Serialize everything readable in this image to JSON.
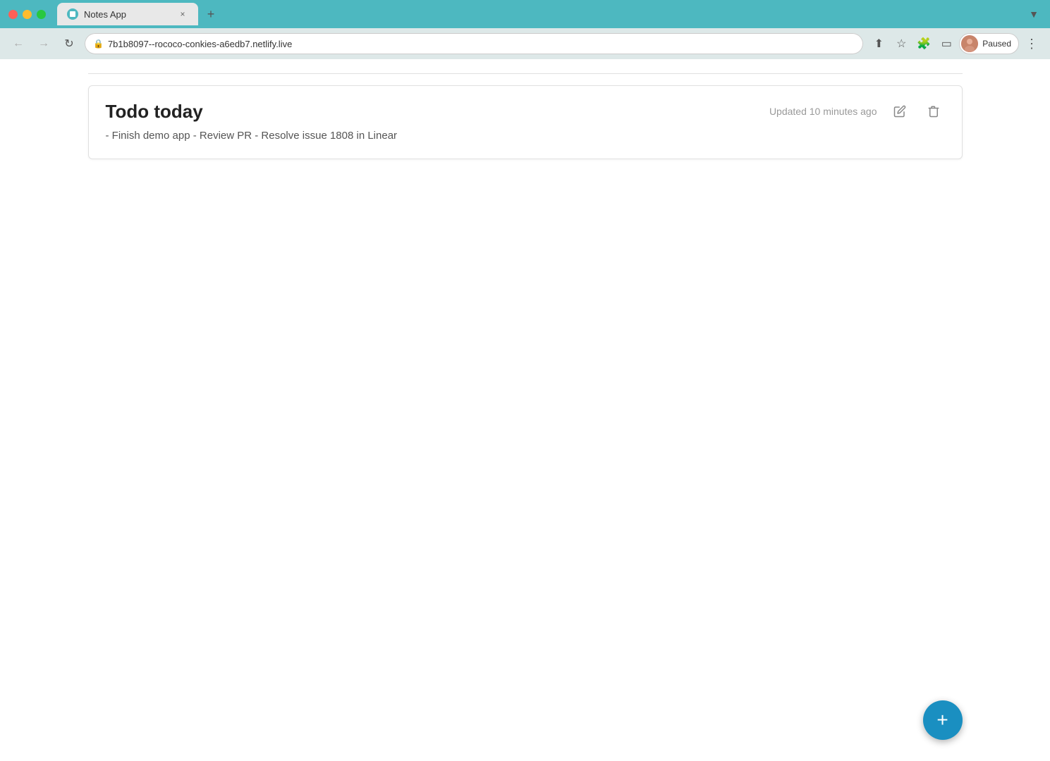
{
  "browser": {
    "tab": {
      "title": "Notes App",
      "icon_label": "notes-app-icon"
    },
    "new_tab_label": "+",
    "url": "7b1b8097--rococo-conkies-a6edb7.netlify.live",
    "dropdown_label": "▼",
    "nav": {
      "back_label": "←",
      "forward_label": "→",
      "reload_label": "↻"
    },
    "user_status": "Paused",
    "more_label": "⋮"
  },
  "notes": {
    "card": {
      "title": "Todo today",
      "updated": "Updated 10 minutes ago",
      "body": "- Finish demo app - Review PR - Resolve issue 1808 in Linear",
      "edit_label": "✏",
      "delete_label": "🗑"
    }
  },
  "fab": {
    "label": "+"
  },
  "colors": {
    "browser_chrome": "#4db8c0",
    "address_bar_bg": "#dde8e8",
    "fab_bg": "#1a8fc1",
    "page_bg": "#ffffff"
  }
}
